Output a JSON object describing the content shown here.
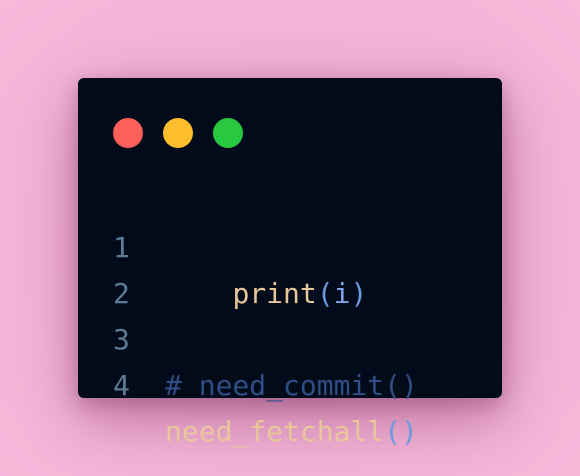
{
  "colors": {
    "background": "#f5b4d8",
    "window": "#010b19",
    "dot_red": "#ff5f5a",
    "dot_yellow": "#ffbd2e",
    "dot_green": "#28c940",
    "line_number": "#5d7a96",
    "function": "#e8c79a",
    "paren": "#6b9ae0",
    "comment": "#304e86"
  },
  "window_controls": {
    "close_icon": "red-circle",
    "minimize_icon": "yellow-circle",
    "maximize_icon": "green-circle"
  },
  "lines": [
    {
      "number": "1",
      "indent": "    ",
      "func": "print",
      "open": "(",
      "arg": "i",
      "close": ")"
    },
    {
      "number": "2"
    },
    {
      "number": "3",
      "comment": "# need_commit()"
    },
    {
      "number": "4",
      "func": "need_fetchall",
      "open": "(",
      "close": ")"
    }
  ]
}
